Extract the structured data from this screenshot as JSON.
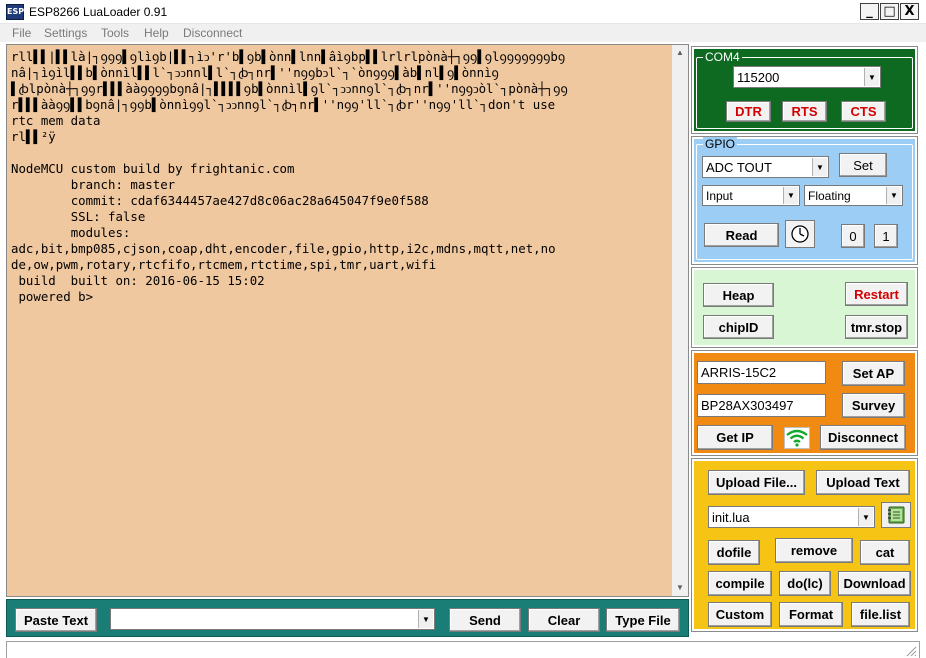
{
  "window": {
    "app_icon_text": "ESP",
    "title": "ESP8266 LuaLoader 0.91",
    "minimize": "_",
    "maximize": "□",
    "close": "X"
  },
  "menu": [
    "File",
    "Settings",
    "Tools",
    "Help",
    "Disconnect"
  ],
  "terminal": {
    "text": "rll▌▌|▌▌là|┐ꝯꝯꝯ▌ꝯlìꝯb|▌▌┐ìↄ'r'b▌ꝯb▌ònn▌lnn▌âìꝯbp▌▌lrlrlpònà┼┐ꝯꝯ▌ꝯlꝯꝯꝯꝯꝯꝯꝯbꝯ\nnâ|┐ìꝯìl▌▌b▌ònnìl▌▌l`┐ↄↄnnl▌l`┐ꞗ┐nr▌''nꝯꝯbↄl`┐`ònꝯꝯꝯ▌àb▌nl▌ꝯ▌ònnìꝯ\n▌ꞗlpònà┼┐ꝯꝯr▌▌▌ààꝯꝯꝯꝯbꝯnâ|┐▌▌▌▌ꝯb▌ònnìl▌ꝯl`┐ↄↄnnꝯl`┐ꞗ┐nr▌''nꝯꝯↄòl`┐pònà┼┐ꝯꝯ\nr▌▌▌ààꝯꝯ▌▌bꝯnâ|┐ꝯꝯb▌ònnìꝯꝯl`┐ↄↄnnꝯl`┐ꞗ┐nr▌''nꝯꝯ'll`┐ꞗr''nꝯꝯ'll`┐don't use\nrtc mem data\nrl▌▌²ÿ\n\nNodeMCU custom build by frightanic.com\n        branch: master\n        commit: cdaf6344457ae427d8c06ac28a645047f9e0f588\n        SSL: false\n        modules:\nadc,bit,bmp085,cjson,coap,dht,encoder,file,gpio,http,i2c,mdns,mqtt,net,no\nde,ow,pwm,rotary,rtcfifo,rtcmem,rtctime,spi,tmr,uart,wifi\n build  built on: 2016-06-15 15:02\n powered b>"
  },
  "bottom": {
    "paste_text": "Paste Text",
    "send": "Send",
    "clear": "Clear",
    "type_file": "Type File",
    "command_value": ""
  },
  "com": {
    "label": "COM4",
    "baud": "115200",
    "dtr": "DTR",
    "rts": "RTS",
    "cts": "CTS"
  },
  "gpio": {
    "label": "GPIO",
    "pin": "ADC  TOUT",
    "set": "Set",
    "mode": "Input",
    "pull": "Floating",
    "read": "Read",
    "zero": "0",
    "one": "1"
  },
  "misc": {
    "heap": "Heap",
    "restart": "Restart",
    "chipid": "chipID",
    "tmr_stop": "tmr.stop"
  },
  "wifi": {
    "ssid": "ARRIS-15C2",
    "password": "BP28AX303497",
    "set_ap": "Set AP",
    "survey": "Survey",
    "get_ip": "Get IP",
    "disconnect": "Disconnect"
  },
  "files": {
    "upload_file": "Upload File...",
    "upload_text": "Upload Text",
    "selected_file": "init.lua",
    "dofile": "dofile",
    "remove": "remove",
    "cat": "cat",
    "compile": "compile",
    "do_lc": "do(lc)",
    "download": "Download",
    "custom": "Custom",
    "format": "Format",
    "file_list": "file.list"
  },
  "colors": {
    "terminal_bg": "#f0c8a0",
    "com_panel": "#0e6a20",
    "gpio_panel": "#9ccdf5",
    "heap_panel": "#d8f5d4",
    "wifi_panel": "#f08a12",
    "file_panel": "#f5c414",
    "bottom_bar": "#1b7e76",
    "alert_red": "#d40000"
  },
  "icons": {
    "app": "esp-app-icon",
    "clock": "clock-icon",
    "wifi": "wifi-signal-icon",
    "notebook": "notebook-icon"
  }
}
